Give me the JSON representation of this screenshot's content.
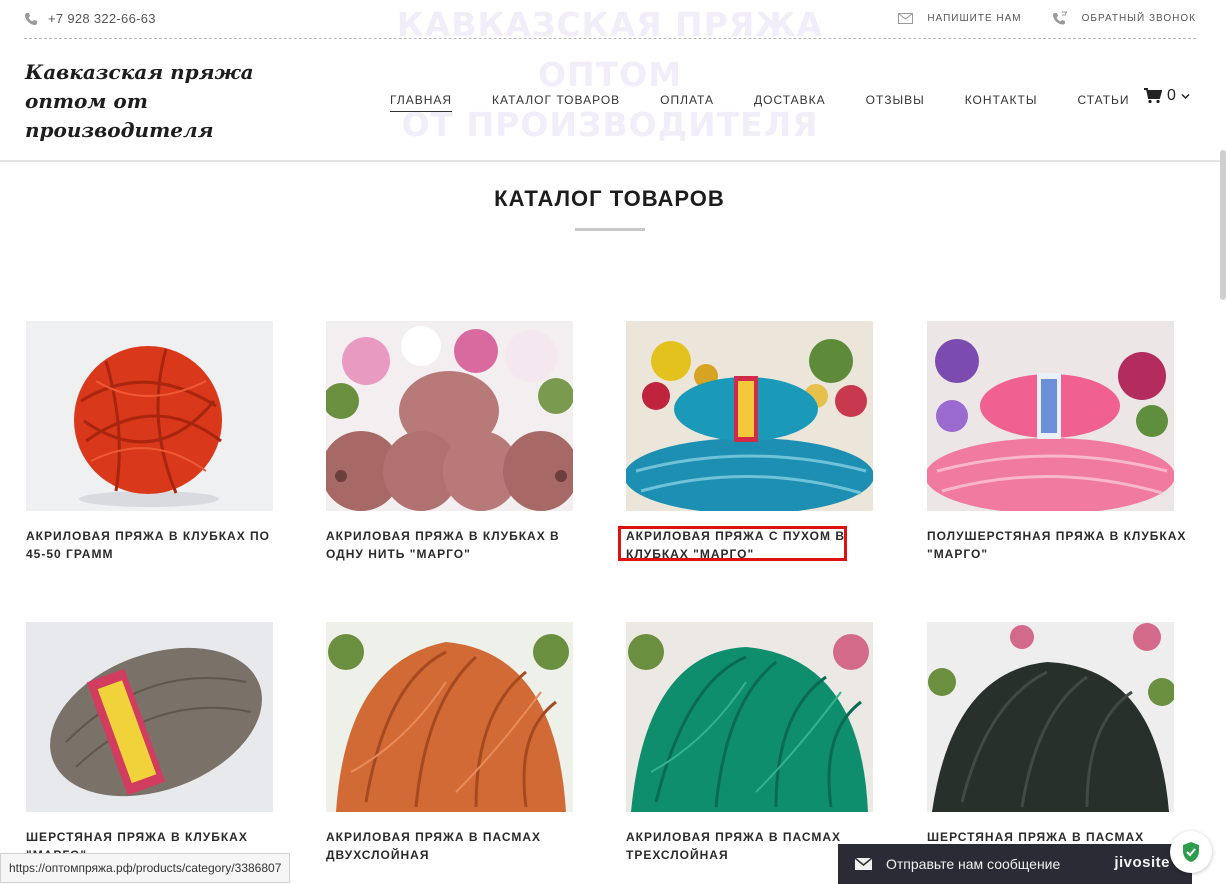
{
  "topbar": {
    "phone": "+7 928 322-66-63",
    "write_us": "НАПИШИТЕ НАМ",
    "callback": "ОБРАТНЫЙ ЗВОНОК",
    "phone_icon": "phone-icon",
    "mail_icon": "mail-icon",
    "callback_icon": "callback-phone-icon"
  },
  "watermark": {
    "line1": "КАВКАЗСКАЯ ПРЯЖА ОПТОМ",
    "line2": "ОТ ПРОИЗВОДИТЕЛЯ"
  },
  "header": {
    "logo": "Кавказская пряжа оптом от производителя",
    "nav": [
      {
        "label": "ГЛАВНАЯ",
        "active": true
      },
      {
        "label": "КАТАЛОГ ТОВАРОВ",
        "active": false
      },
      {
        "label": "ОПЛАТА",
        "active": false
      },
      {
        "label": "ДОСТАВКА",
        "active": false
      },
      {
        "label": "ОТЗЫВЫ",
        "active": false
      },
      {
        "label": "КОНТАКТЫ",
        "active": false
      },
      {
        "label": "СТАТЬИ",
        "active": false
      }
    ],
    "cart_count": "0",
    "cart_icon": "cart-icon"
  },
  "catalog": {
    "title": "КАТАЛОГ ТОВАРОВ",
    "products": [
      {
        "name": "АКРИЛОВАЯ ПРЯЖА В КЛУБКАХ ПО 45-50 ГРАММ",
        "color": "#d9381a"
      },
      {
        "name": "АКРИЛОВАЯ ПРЯЖА В КЛУБКАХ В ОДНУ НИТЬ \"МАРГО\"",
        "color": "#b87a78"
      },
      {
        "name": "АКРИЛОВАЯ ПРЯЖА С ПУХОМ В КЛУБКАХ \"МАРГО\"",
        "color": "#1a9ab8"
      },
      {
        "name": "ПОЛУШЕРСТЯНАЯ ПРЯЖА В КЛУБКАХ \"МАРГО\"",
        "color": "#f06090"
      },
      {
        "name": "ШЕРСТЯНАЯ ПРЯЖА В КЛУБКАХ \"МАРГО\"",
        "color": "#7a7268"
      },
      {
        "name": "АКРИЛОВАЯ ПРЯЖА В ПАСМАХ ДВУХСЛОЙНАЯ",
        "color": "#d26a36"
      },
      {
        "name": "АКРИЛОВАЯ ПРЯЖА В ПАСМАХ ТРЕХСЛОЙНАЯ",
        "color": "#0f8e6e"
      },
      {
        "name": "ШЕРСТЯНАЯ ПРЯЖА В ПАСМАХ",
        "color": "#27302b"
      }
    ],
    "highlighted_index": 2
  },
  "status_bar": {
    "url": "https://оптомпряжа.рф/products/category/3386807"
  },
  "jivo": {
    "message": "Отправьте нам сообщение",
    "brand": "jivosite",
    "accent": "#2b2b35"
  }
}
